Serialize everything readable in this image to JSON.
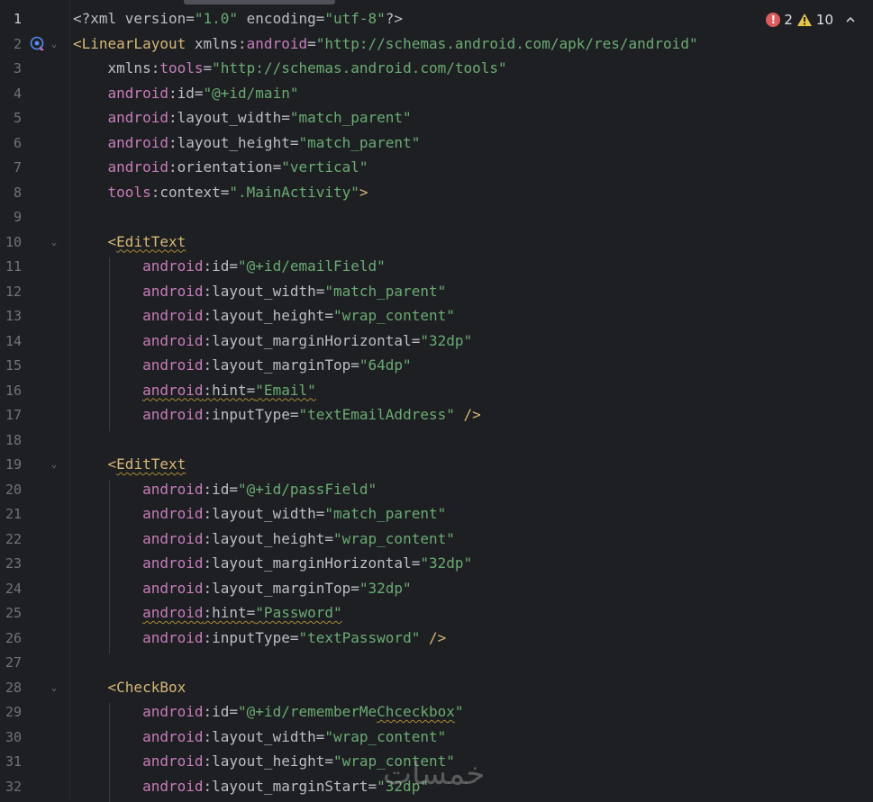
{
  "inspection": {
    "errors": "2",
    "warnings": "10"
  },
  "lines": [
    {
      "n": "1",
      "active": true
    },
    {
      "n": "2"
    },
    {
      "n": "3"
    },
    {
      "n": "4"
    },
    {
      "n": "5"
    },
    {
      "n": "6"
    },
    {
      "n": "7"
    },
    {
      "n": "8"
    },
    {
      "n": "9"
    },
    {
      "n": "10"
    },
    {
      "n": "11"
    },
    {
      "n": "12"
    },
    {
      "n": "13"
    },
    {
      "n": "14"
    },
    {
      "n": "15"
    },
    {
      "n": "16"
    },
    {
      "n": "17"
    },
    {
      "n": "18"
    },
    {
      "n": "19"
    },
    {
      "n": "20"
    },
    {
      "n": "21"
    },
    {
      "n": "22"
    },
    {
      "n": "23"
    },
    {
      "n": "24"
    },
    {
      "n": "25"
    },
    {
      "n": "26"
    },
    {
      "n": "27"
    },
    {
      "n": "28"
    },
    {
      "n": "29"
    },
    {
      "n": "30"
    },
    {
      "n": "31"
    },
    {
      "n": "32"
    }
  ],
  "fold_lines": [
    2,
    10,
    19,
    28
  ],
  "code": [
    [
      [
        "p",
        "<?xml "
      ],
      [
        "a",
        "version="
      ],
      [
        "v",
        "\"1.0\""
      ],
      [
        "a",
        " encoding="
      ],
      [
        "v",
        "\"utf-8\""
      ],
      [
        "p",
        "?>"
      ]
    ],
    [
      [
        "t",
        "<LinearLayout "
      ],
      [
        "a",
        "xmlns:"
      ],
      [
        "ns",
        "android"
      ],
      [
        "a",
        "="
      ],
      [
        "v",
        "\"http://schemas.android.com/apk/res/android\""
      ]
    ],
    [
      [
        "a",
        "    xmlns:"
      ],
      [
        "ns",
        "tools"
      ],
      [
        "a",
        "="
      ],
      [
        "v",
        "\"http://schemas.android.com/tools\""
      ]
    ],
    [
      [
        "ns",
        "    android"
      ],
      [
        "a",
        ":id="
      ],
      [
        "v",
        "\"@+id/main\""
      ]
    ],
    [
      [
        "ns",
        "    android"
      ],
      [
        "a",
        ":layout_width="
      ],
      [
        "v",
        "\"match_parent\""
      ]
    ],
    [
      [
        "ns",
        "    android"
      ],
      [
        "a",
        ":layout_height="
      ],
      [
        "v",
        "\"match_parent\""
      ]
    ],
    [
      [
        "ns",
        "    android"
      ],
      [
        "a",
        ":orientation="
      ],
      [
        "v",
        "\"vertical\""
      ]
    ],
    [
      [
        "ns",
        "    tools"
      ],
      [
        "a",
        ":context="
      ],
      [
        "v",
        "\".MainActivity\""
      ],
      [
        "t",
        ">"
      ]
    ],
    [],
    [
      [
        "t",
        "    <"
      ],
      [
        "tw",
        "EditText"
      ]
    ],
    [
      [
        "ns",
        "        android"
      ],
      [
        "a",
        ":id="
      ],
      [
        "v",
        "\"@+id/emailField\""
      ]
    ],
    [
      [
        "ns",
        "        android"
      ],
      [
        "a",
        ":layout_width="
      ],
      [
        "v",
        "\"match_parent\""
      ]
    ],
    [
      [
        "ns",
        "        android"
      ],
      [
        "a",
        ":layout_height="
      ],
      [
        "v",
        "\"wrap_content\""
      ]
    ],
    [
      [
        "ns",
        "        android"
      ],
      [
        "a",
        ":layout_marginHorizontal="
      ],
      [
        "v",
        "\"32dp\""
      ]
    ],
    [
      [
        "ns",
        "        android"
      ],
      [
        "a",
        ":layout_marginTop="
      ],
      [
        "v",
        "\"64dp\""
      ]
    ],
    [
      [
        "ns",
        "        "
      ],
      [
        "nsw",
        "android"
      ],
      [
        "aw",
        ":hint="
      ],
      [
        "vw",
        "\"Email\""
      ]
    ],
    [
      [
        "ns",
        "        android"
      ],
      [
        "a",
        ":inputType="
      ],
      [
        "v",
        "\"textEmailAddress\""
      ],
      [
        "t",
        " />"
      ]
    ],
    [],
    [
      [
        "t",
        "    <"
      ],
      [
        "tw",
        "EditText"
      ]
    ],
    [
      [
        "ns",
        "        android"
      ],
      [
        "a",
        ":id="
      ],
      [
        "v",
        "\"@+id/passField\""
      ]
    ],
    [
      [
        "ns",
        "        android"
      ],
      [
        "a",
        ":layout_width="
      ],
      [
        "v",
        "\"match_parent\""
      ]
    ],
    [
      [
        "ns",
        "        android"
      ],
      [
        "a",
        ":layout_height="
      ],
      [
        "v",
        "\"wrap_content\""
      ]
    ],
    [
      [
        "ns",
        "        android"
      ],
      [
        "a",
        ":layout_marginHorizontal="
      ],
      [
        "v",
        "\"32dp\""
      ]
    ],
    [
      [
        "ns",
        "        android"
      ],
      [
        "a",
        ":layout_marginTop="
      ],
      [
        "v",
        "\"32dp\""
      ]
    ],
    [
      [
        "ns",
        "        "
      ],
      [
        "nsw",
        "android"
      ],
      [
        "aw",
        ":hint="
      ],
      [
        "vw",
        "\"Password\""
      ]
    ],
    [
      [
        "ns",
        "        android"
      ],
      [
        "a",
        ":inputType="
      ],
      [
        "v",
        "\"textPassword\""
      ],
      [
        "t",
        " />"
      ]
    ],
    [],
    [
      [
        "t",
        "    <CheckBox"
      ]
    ],
    [
      [
        "ns",
        "        android"
      ],
      [
        "a",
        ":id="
      ],
      [
        "v",
        "\"@+id/rememberMe"
      ],
      [
        "vw",
        "Chceckbox"
      ],
      [
        "v",
        "\""
      ]
    ],
    [
      [
        "ns",
        "        android"
      ],
      [
        "a",
        ":layout_width="
      ],
      [
        "v",
        "\"wrap_content\""
      ]
    ],
    [
      [
        "ns",
        "        android"
      ],
      [
        "a",
        ":layout_height="
      ],
      [
        "v",
        "\"wrap_content\""
      ]
    ],
    [
      [
        "ns",
        "        android"
      ],
      [
        "a",
        ":layout_marginStart="
      ],
      [
        "v",
        "\"32dp\""
      ]
    ]
  ],
  "watermark": "خمسات",
  "colors": {
    "background": "#1e1f22",
    "tag": "#d5b778",
    "namespace": "#c77dbb",
    "string": "#6aab73",
    "text": "#bcbec4",
    "error": "#db5c5c",
    "warning": "#e8c54a"
  }
}
